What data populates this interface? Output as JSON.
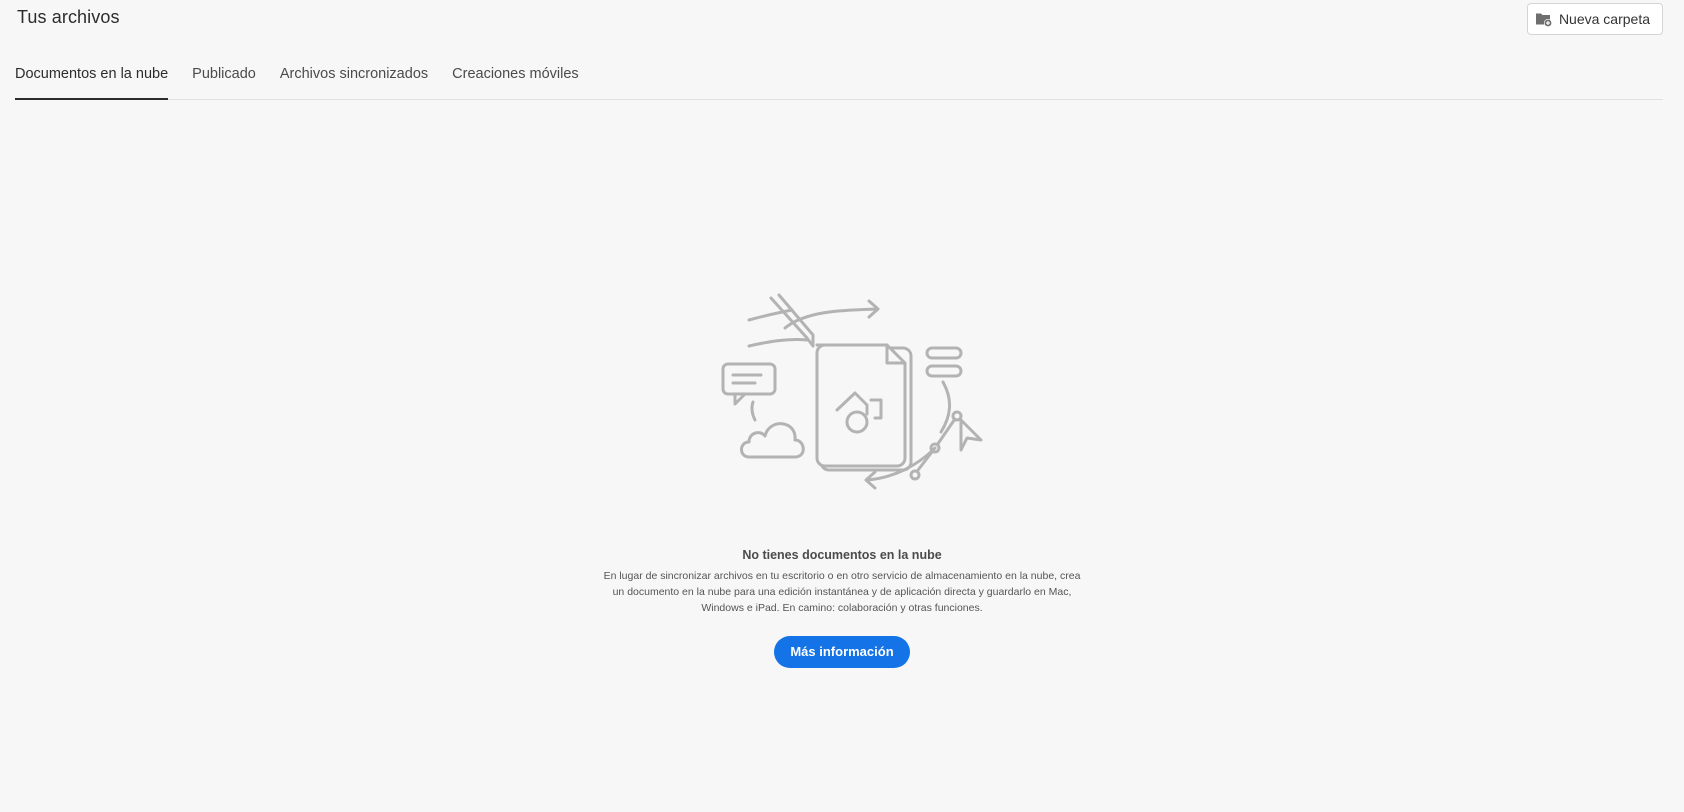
{
  "header": {
    "title": "Tus archivos",
    "new_folder_label": "Nueva carpeta",
    "new_folder_icon": "folder-add-icon"
  },
  "tabs": [
    {
      "label": "Documentos en la nube",
      "active": true
    },
    {
      "label": "Publicado",
      "active": false
    },
    {
      "label": "Archivos sincronizados",
      "active": false
    },
    {
      "label": "Creaciones móviles",
      "active": false
    }
  ],
  "empty_state": {
    "illustration": "cloud-document-illustration",
    "title": "No tienes documentos en la nube",
    "description": "En lugar de sincronizar archivos en tu escritorio o en otro servicio de almacenamiento en la nube, crea un documento en la nube para una edición instantánea y de aplicación directa y guardarlo en Mac, Windows e iPad. En camino: colaboración y otras funciones.",
    "button_label": "Más información"
  },
  "colors": {
    "background": "#f7f7f7",
    "accent": "#1473e6",
    "illustration_stroke": "#b3b3b3"
  }
}
